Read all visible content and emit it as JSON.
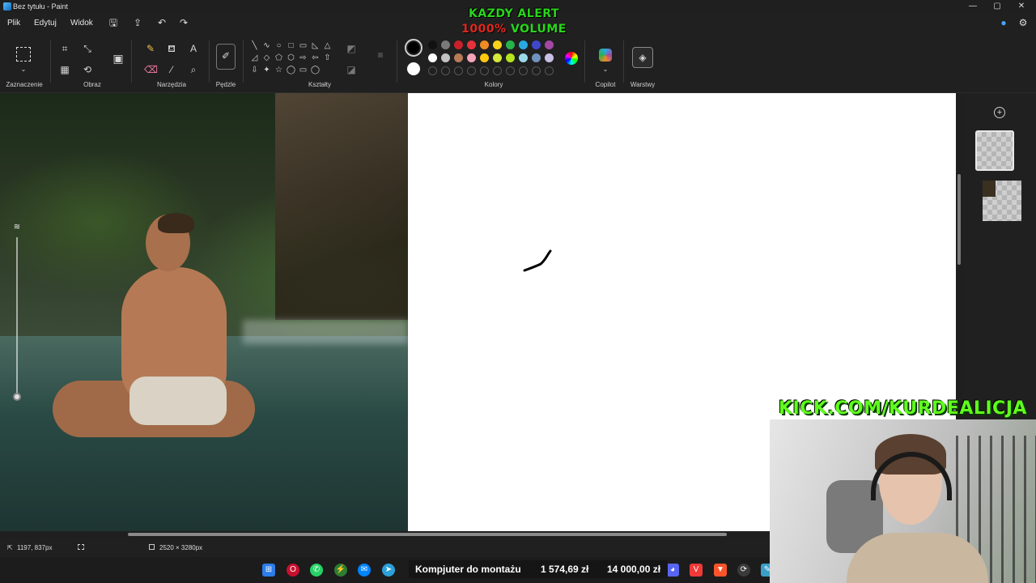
{
  "window": {
    "title": "Bez tytułu - Paint",
    "controls": [
      "—",
      "▢",
      "✕"
    ]
  },
  "overlay": {
    "alert_line1": "KAZDY ALERT",
    "alert_pct": "1000%",
    "alert_volume": "VOLUME",
    "kick_url": "KICK.COM/KURDEALICJA"
  },
  "menu": {
    "file": "Plik",
    "edit": "Edytuj",
    "view": "Widok"
  },
  "ribbon": {
    "groups": {
      "selection": "Zaznaczenie",
      "image": "Obraz",
      "tools": "Narzędzia",
      "brushes": "Pędzle",
      "shapes": "Kształty",
      "colors": "Kolory",
      "copilot": "Copilot",
      "layers": "Warstwy"
    },
    "shape_glyphs": [
      "╲",
      "∿",
      "○",
      "□",
      "▭",
      "◺",
      "△",
      "◿",
      "◇",
      "⬠",
      "⬡",
      "⇨",
      "⇦",
      "⇧",
      "⇩",
      "✦",
      "☆",
      "◯",
      "▭",
      "◯"
    ],
    "color_row1": [
      "#111111",
      "#7a7a7a",
      "#c8202a",
      "#e5323b",
      "#f08a24",
      "#f7d21a",
      "#27b24a",
      "#29a9e0",
      "#3f48cc",
      "#a349a4"
    ],
    "color_row2": [
      "#ffffff",
      "#c3c3c3",
      "#b97a57",
      "#f5a3b8",
      "#ffc90e",
      "#d6e83a",
      "#b5e61d",
      "#99d9ea",
      "#7092be",
      "#c8bfe7"
    ],
    "primary_color": "#000000",
    "secondary_color": "#ffffff"
  },
  "canvas": {
    "zoom_icon": "≋"
  },
  "status": {
    "cursor_pos": "1197, 837px",
    "image_size": "2520 × 3280px"
  },
  "taskbar": {
    "ticker_label": "Kompjuter do montażu",
    "ticker_price": "1 574,69 zł",
    "ticker_goal": "14 000,00 zł"
  }
}
